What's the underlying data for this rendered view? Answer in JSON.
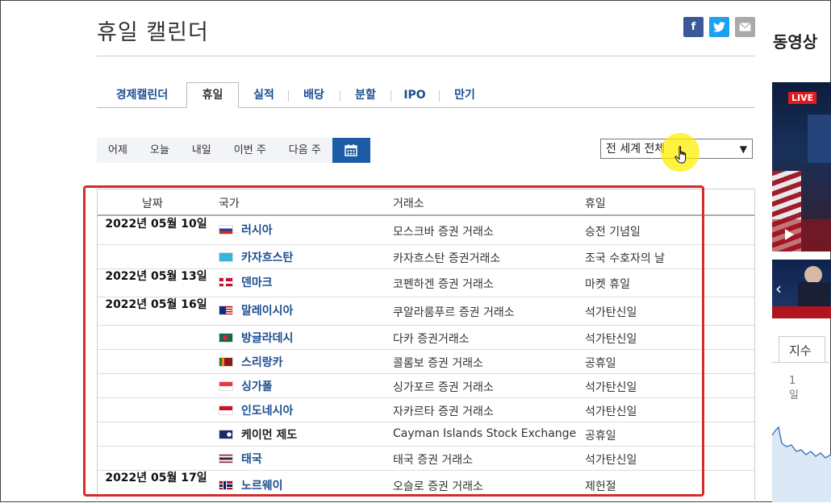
{
  "page": {
    "title": "휴일 캘린더"
  },
  "share": {
    "facebook": "f"
  },
  "tabs": [
    "경제캘린더",
    "휴일",
    "실적",
    "배당",
    "분할",
    "IPO",
    "만기"
  ],
  "date_buttons": [
    "어제",
    "오늘",
    "내일",
    "이번 주",
    "다음 주"
  ],
  "region_select": {
    "value": "전 세계 전체"
  },
  "table": {
    "headers": {
      "date": "날짜",
      "country": "국가",
      "exchange": "거래소",
      "holiday": "휴일"
    },
    "rows": [
      {
        "date": "2022년 05월 10일",
        "country": "러시아",
        "exchange": "모스크바 증권 거래소",
        "holiday": "승전 기념일"
      },
      {
        "date": "",
        "country": "카자흐스탄",
        "exchange": "카자흐스탄 증권거래소",
        "holiday": "조국 수호자의 날"
      },
      {
        "date": "2022년 05월 13일",
        "country": "덴마크",
        "exchange": "코펜하겐 증권 거래소",
        "holiday": "마켓 휴일"
      },
      {
        "date": "2022년 05월 16일",
        "country": "말레이시아",
        "exchange": "쿠알라룸푸르 증권 거래소",
        "holiday": "석가탄신일"
      },
      {
        "date": "",
        "country": "방글라데시",
        "exchange": "다카 증권거래소",
        "holiday": "석가탄신일"
      },
      {
        "date": "",
        "country": "스리랑카",
        "exchange": "콜롬보 증권 거래소",
        "holiday": "공휴일"
      },
      {
        "date": "",
        "country": "싱가폴",
        "exchange": "싱가포르 증권 거래소",
        "holiday": "석가탄신일"
      },
      {
        "date": "",
        "country": "인도네시아",
        "exchange": "자카르타 증권 거래소",
        "holiday": "석가탄신일"
      },
      {
        "date": "",
        "country": "케이먼 제도",
        "exchange": "Cayman Islands Stock Exchange",
        "holiday": "공휴일"
      },
      {
        "date": "",
        "country": "태국",
        "exchange": "태국 증권 거래소",
        "holiday": "석가탄신일"
      },
      {
        "date": "2022년 05월 17일",
        "country": "노르웨이",
        "exchange": "오슬로 증권 거래소",
        "holiday": "제헌절"
      }
    ]
  },
  "sidebar": {
    "title": "동영상",
    "live_badge": "LIVE",
    "tab": "지수",
    "number_label": "1 일"
  }
}
